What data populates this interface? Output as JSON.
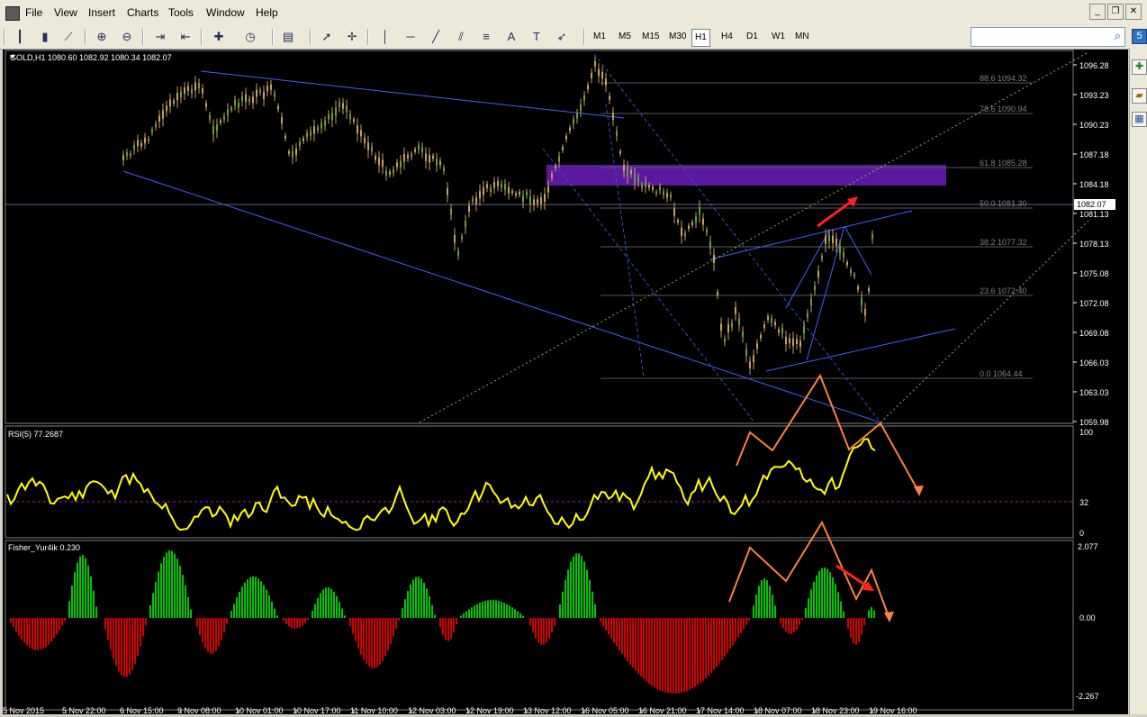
{
  "menu": {
    "items": [
      "File",
      "View",
      "Insert",
      "Charts",
      "Tools",
      "Window",
      "Help"
    ]
  },
  "toolbar": {
    "timeframes": [
      "M1",
      "M5",
      "M15",
      "M30",
      "H1",
      "H4",
      "D1",
      "W1",
      "MN"
    ],
    "active_timeframe": "H1",
    "cursor_tool_label": "A"
  },
  "side": {
    "badge": "5"
  },
  "chart": {
    "header": "GOLD,H1  1080.60 1082.92 1080.34 1082.07",
    "current_price": "1082.07",
    "price_ticks": [
      "1096.28",
      "1093.23",
      "1090.23",
      "1087.18",
      "1084.18",
      "1081.13",
      "1078.13",
      "1075.08",
      "1072.08",
      "1069.08",
      "1066.03",
      "1063.03",
      "1059.98"
    ],
    "fib_levels": [
      "88.6 1094.32",
      "78.6 1090.94",
      "61.8 1085.28",
      "50.0 1081.30",
      "38.2 1077.32",
      "23.6 1072.40",
      "0.0 1064.44"
    ],
    "time_ticks": [
      "5 Nov 2015",
      "5 Nov 22:00",
      "6 Nov 15:00",
      "9 Nov 08:00",
      "10 Nov 01:00",
      "10 Nov 17:00",
      "11 Nov 10:00",
      "12 Nov 03:00",
      "12 Nov 19:00",
      "13 Nov 12:00",
      "16 Nov 05:00",
      "16 Nov 21:00",
      "17 Nov 14:00",
      "18 Nov 07:00",
      "18 Nov 23:00",
      "19 Nov 16:00"
    ]
  },
  "rsi": {
    "label": "RSI(5) 77.2687",
    "ticks": [
      "100",
      "32",
      "0"
    ]
  },
  "fisher": {
    "label": "Fisher_Yur4ik 0.230",
    "ticks": [
      "2.077",
      "0.00",
      "-2.267"
    ]
  },
  "colors": {
    "background": "#000000",
    "candle": "#c8a060",
    "trendline": "#4060ff",
    "supply_zone": "#5a1aa0",
    "rsi_line": "#ffff00",
    "fisher_up": "#00c800",
    "fisher_down": "#d00000",
    "annotation_orange": "#ff8040",
    "annotation_red": "#ff2020",
    "fib_line": "#5a5a5a",
    "dashed_green": "#80c040"
  }
}
